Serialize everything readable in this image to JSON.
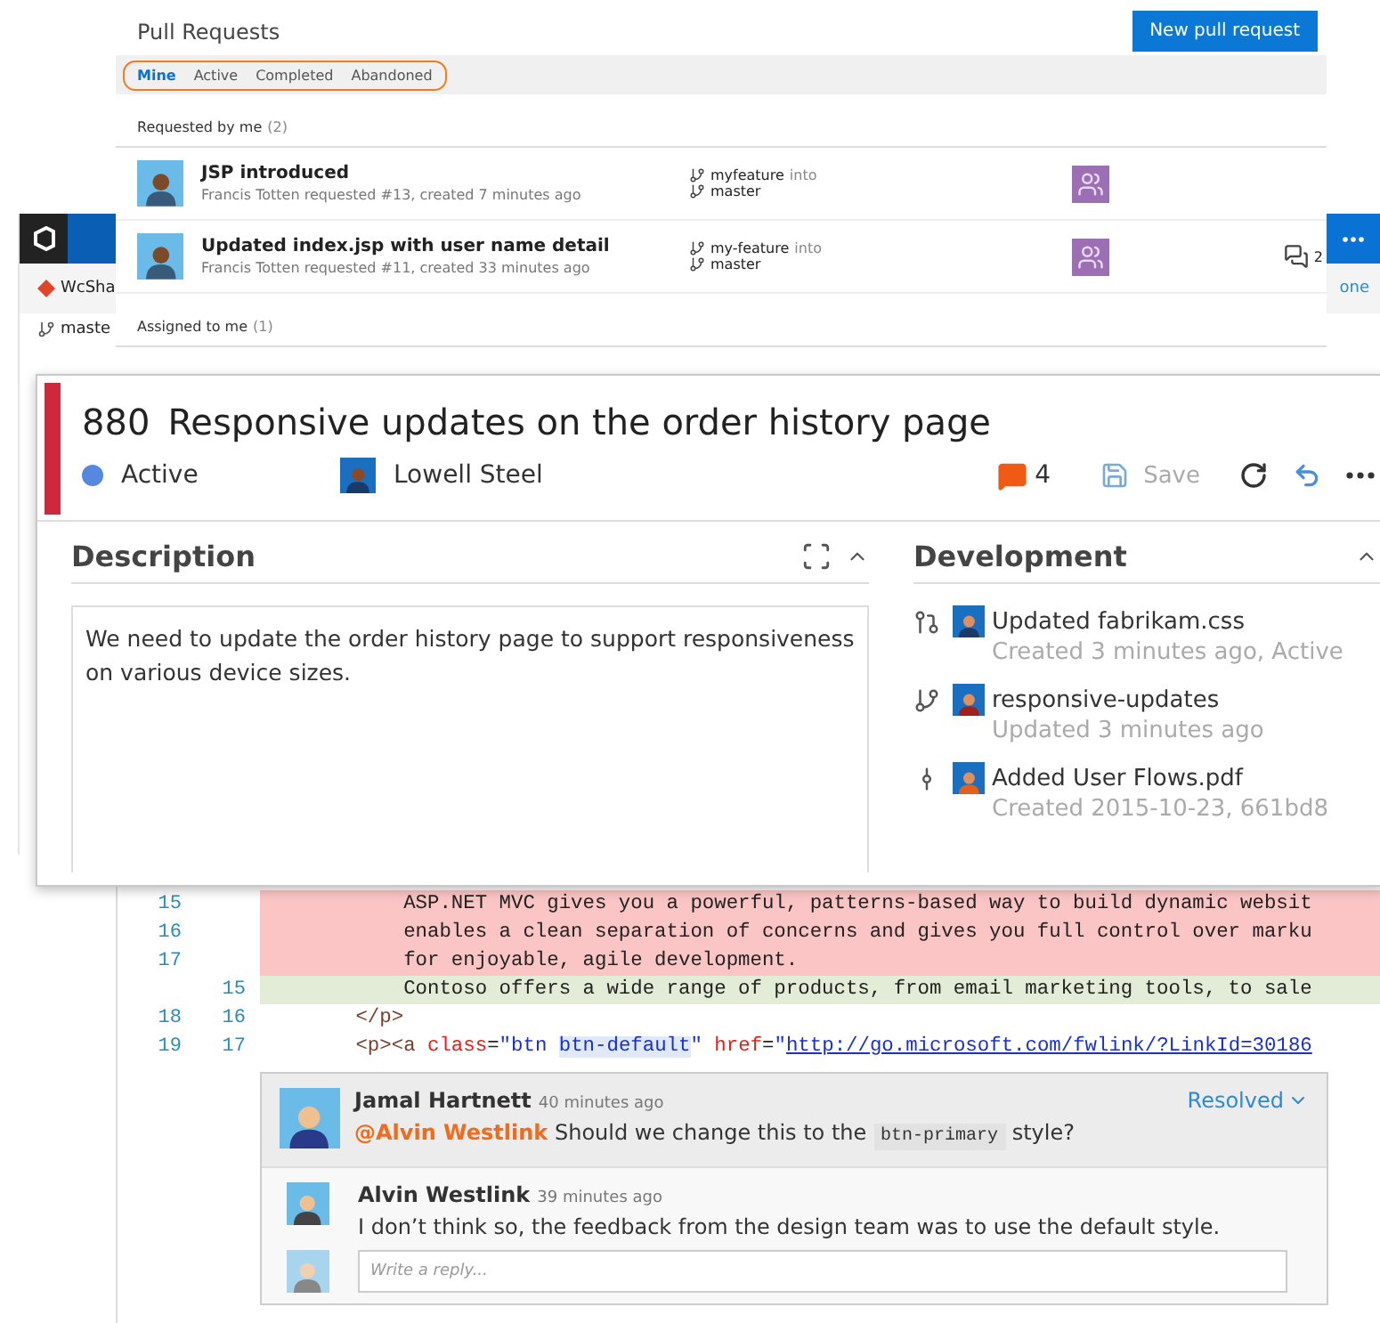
{
  "background_window": {
    "repo_name": "WcSha",
    "link_text": "one",
    "branch": "maste"
  },
  "pull_requests": {
    "title": "Pull Requests",
    "new_button": "New pull request",
    "tabs": [
      {
        "label": "Mine",
        "selected": true
      },
      {
        "label": "Active",
        "selected": false
      },
      {
        "label": "Completed",
        "selected": false
      },
      {
        "label": "Abandoned",
        "selected": false
      }
    ],
    "sections": [
      {
        "label": "Requested by me",
        "count": "(2)",
        "rows": [
          {
            "title": "JSP introduced",
            "subtitle": "Francis Totten requested #13, created 7 minutes ago",
            "source_branch": "myfeature",
            "into": "into",
            "target_branch": "master"
          },
          {
            "title": "Updated index.jsp with user name detail",
            "subtitle": "Francis Totten requested #11, created 33 minutes ago",
            "source_branch": "my-feature",
            "into": "into",
            "target_branch": "master",
            "comments": "2"
          }
        ]
      },
      {
        "label": "Assigned to me",
        "count": "(1)"
      }
    ]
  },
  "work_item": {
    "id": "880",
    "title": "Responsive updates on the order history page",
    "state": {
      "label": "Active",
      "color": "#5688e0"
    },
    "assignee": "Lowell Steel",
    "comment_count": "4",
    "save": {
      "label": "Save",
      "disabled": true
    },
    "description": {
      "heading": "Description",
      "text": "We need to update the order history page to support responsiveness on various device sizes."
    },
    "development": {
      "heading": "Development",
      "links": [
        {
          "kind": "pull_request",
          "title": "Updated fabrikam.css",
          "detail": "Created 3 minutes ago, Active"
        },
        {
          "kind": "branch",
          "title": "responsive-updates",
          "detail": "Updated 3 minutes ago"
        },
        {
          "kind": "commit",
          "title": "Added User Flows.pdf",
          "detail": "Created 2015-10-23, 661bd8"
        }
      ]
    }
  },
  "diff": {
    "lines": [
      {
        "kind": "deleted",
        "old": "15",
        "tokens": [
          {
            "kind": "plain",
            "text": "            ASP.NET MVC gives you a powerful, patterns-based way to build dynamic websit"
          }
        ]
      },
      {
        "kind": "deleted",
        "old": "16",
        "tokens": [
          {
            "kind": "plain",
            "text": "            enables a clean separation of concerns and gives you full control over marku"
          }
        ]
      },
      {
        "kind": "deleted",
        "old": "17",
        "tokens": [
          {
            "kind": "plain",
            "text": "            for enjoyable, agile development."
          }
        ]
      },
      {
        "kind": "added",
        "new": "15",
        "tokens": [
          {
            "kind": "plain",
            "text": "            Contoso offers a wide range of products, from email marketing tools, to sale"
          }
        ]
      },
      {
        "kind": "context",
        "old": "18",
        "new": "16",
        "tokens": [
          {
            "kind": "tag",
            "text": "        </p>"
          }
        ]
      },
      {
        "kind": "context",
        "old": "19",
        "new": "17",
        "tokens": [
          {
            "kind": "tag",
            "text": "        <p><a "
          },
          {
            "kind": "attr",
            "text": "class"
          },
          {
            "kind": "plain",
            "text": "="
          },
          {
            "kind": "string",
            "text": "\"btn "
          },
          {
            "kind": "match",
            "text": "btn-default"
          },
          {
            "kind": "string",
            "text": "\" "
          },
          {
            "kind": "attr",
            "text": "href"
          },
          {
            "kind": "plain",
            "text": "="
          },
          {
            "kind": "string",
            "text": "\""
          },
          {
            "kind": "link",
            "text": "http://go.microsoft.com/fwlink/?LinkId=30186"
          }
        ]
      }
    ],
    "thread": {
      "status": "Resolved",
      "reply_placeholder": "Write a reply...",
      "comments": [
        {
          "author": "Jamal Hartnett",
          "time": "40 minutes ago",
          "mention": "@Alvin Westlink",
          "text": "Should we change this to the",
          "code": "btn-primary",
          "text_after": "style?"
        },
        {
          "author": "Alvin Westlink",
          "time": "39 minutes ago",
          "text": "I don’t think so, the feedback from the design team was to use the default style."
        }
      ]
    }
  }
}
